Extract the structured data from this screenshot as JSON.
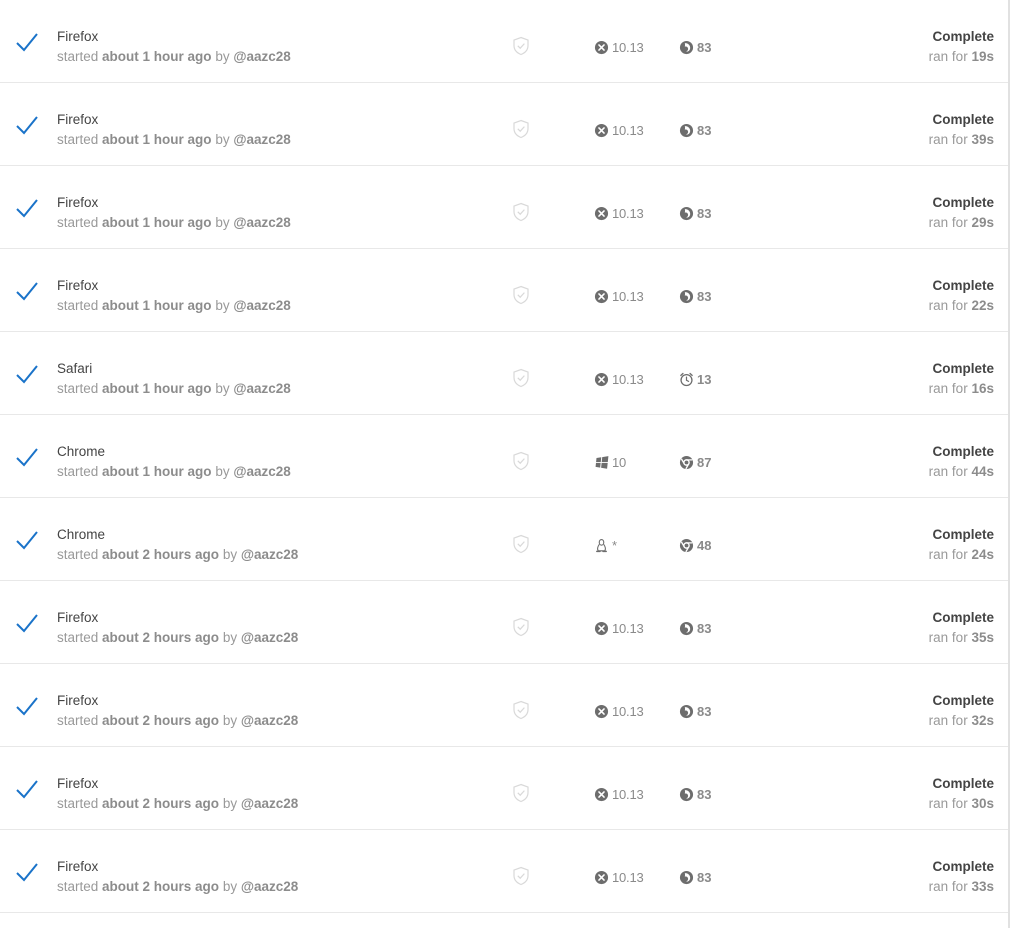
{
  "colors": {
    "check": "#1a73c9",
    "muted": "#999999",
    "text": "#444444"
  },
  "labels": {
    "started": "started",
    "by": "by",
    "ran_for": "ran for"
  },
  "jobs": [
    {
      "browser_name": "Firefox",
      "time_ago": "about 1 hour ago",
      "user": "@aazc28",
      "os_icon": "mac-icon",
      "os_version": "10.13",
      "browser_icon": "firefox-icon",
      "browser_version": "83",
      "status": "Complete",
      "duration": "19s"
    },
    {
      "browser_name": "Firefox",
      "time_ago": "about 1 hour ago",
      "user": "@aazc28",
      "os_icon": "mac-icon",
      "os_version": "10.13",
      "browser_icon": "firefox-icon",
      "browser_version": "83",
      "status": "Complete",
      "duration": "39s"
    },
    {
      "browser_name": "Firefox",
      "time_ago": "about 1 hour ago",
      "user": "@aazc28",
      "os_icon": "mac-icon",
      "os_version": "10.13",
      "browser_icon": "firefox-icon",
      "browser_version": "83",
      "status": "Complete",
      "duration": "29s"
    },
    {
      "browser_name": "Firefox",
      "time_ago": "about 1 hour ago",
      "user": "@aazc28",
      "os_icon": "mac-icon",
      "os_version": "10.13",
      "browser_icon": "firefox-icon",
      "browser_version": "83",
      "status": "Complete",
      "duration": "22s"
    },
    {
      "browser_name": "Safari",
      "time_ago": "about 1 hour ago",
      "user": "@aazc28",
      "os_icon": "mac-icon",
      "os_version": "10.13",
      "browser_icon": "safari-icon",
      "browser_version": "13",
      "status": "Complete",
      "duration": "16s"
    },
    {
      "browser_name": "Chrome",
      "time_ago": "about 1 hour ago",
      "user": "@aazc28",
      "os_icon": "windows-icon",
      "os_version": "10",
      "browser_icon": "chrome-icon",
      "browser_version": "87",
      "status": "Complete",
      "duration": "44s"
    },
    {
      "browser_name": "Chrome",
      "time_ago": "about 2 hours ago",
      "user": "@aazc28",
      "os_icon": "linux-icon",
      "os_version": "*",
      "browser_icon": "chrome-icon",
      "browser_version": "48",
      "status": "Complete",
      "duration": "24s"
    },
    {
      "browser_name": "Firefox",
      "time_ago": "about 2 hours ago",
      "user": "@aazc28",
      "os_icon": "mac-icon",
      "os_version": "10.13",
      "browser_icon": "firefox-icon",
      "browser_version": "83",
      "status": "Complete",
      "duration": "35s"
    },
    {
      "browser_name": "Firefox",
      "time_ago": "about 2 hours ago",
      "user": "@aazc28",
      "os_icon": "mac-icon",
      "os_version": "10.13",
      "browser_icon": "firefox-icon",
      "browser_version": "83",
      "status": "Complete",
      "duration": "32s"
    },
    {
      "browser_name": "Firefox",
      "time_ago": "about 2 hours ago",
      "user": "@aazc28",
      "os_icon": "mac-icon",
      "os_version": "10.13",
      "browser_icon": "firefox-icon",
      "browser_version": "83",
      "status": "Complete",
      "duration": "30s"
    },
    {
      "browser_name": "Firefox",
      "time_ago": "about 2 hours ago",
      "user": "@aazc28",
      "os_icon": "mac-icon",
      "os_version": "10.13",
      "browser_icon": "firefox-icon",
      "browser_version": "83",
      "status": "Complete",
      "duration": "33s"
    }
  ]
}
